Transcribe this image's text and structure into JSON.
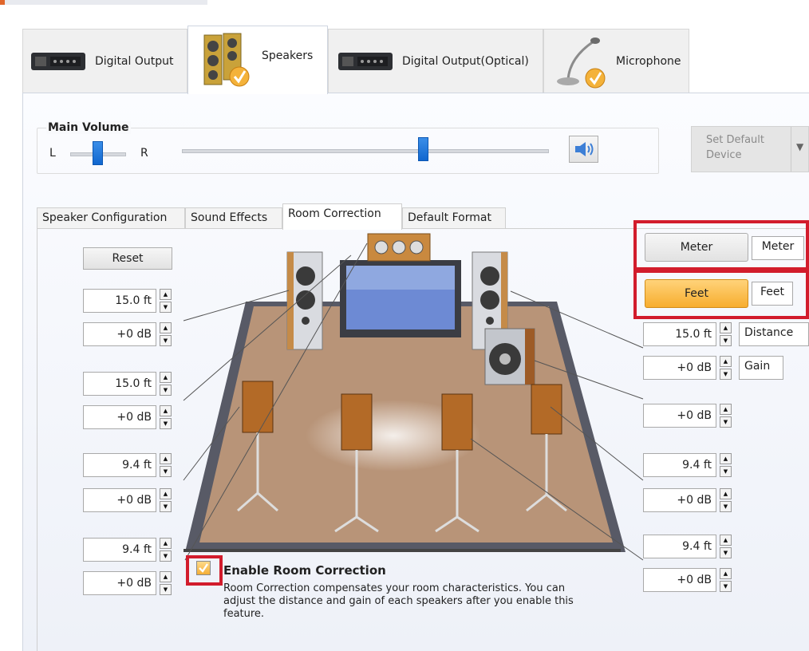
{
  "device_tabs": [
    {
      "label": "Digital Output",
      "icon": "digital-output-device-icon"
    },
    {
      "label": "Speakers",
      "icon": "speakers-device-icon"
    },
    {
      "label": "Digital Output(Optical)",
      "icon": "optical-output-device-icon"
    },
    {
      "label": "Microphone",
      "icon": "microphone-device-icon"
    }
  ],
  "main_volume": {
    "title": "Main Volume",
    "left_label": "L",
    "right_label": "R",
    "balance_level": 0.5,
    "volume_level": 0.66
  },
  "set_default": {
    "line1": "Set Default",
    "line2": "Device"
  },
  "sub_tabs": [
    "Speaker Configuration",
    "Sound Effects",
    "Room Correction",
    "Default Format"
  ],
  "reset_label": "Reset",
  "unit_meter": {
    "button": "Meter",
    "label": "Meter"
  },
  "unit_feet": {
    "button": "Feet",
    "label": "Feet"
  },
  "distance_label": "Distance",
  "gain_label": "Gain",
  "left_controls": [
    {
      "distance": "15.0 ft",
      "gain": "+0 dB"
    },
    {
      "distance": "15.0 ft",
      "gain": "+0 dB"
    },
    {
      "distance": "9.4 ft",
      "gain": "+0 dB"
    },
    {
      "distance": "9.4 ft",
      "gain": "+0 dB"
    }
  ],
  "right_controls": {
    "front": {
      "distance": "15.0 ft",
      "gain": "+0 dB"
    },
    "sub": {
      "gain": "+0 dB"
    },
    "side": {
      "distance": "9.4 ft",
      "gain": "+0 dB"
    },
    "rear": {
      "distance": "9.4 ft",
      "gain": "+0 dB"
    }
  },
  "room_correction": {
    "checked": true,
    "title": "Enable Room Correction",
    "description_lines": [
      "Room Correction compensates your room characteristics. You can",
      "adjust the distance and gain of each speakers after you enable this",
      "feature."
    ]
  },
  "colors": {
    "accent_blue": "#1167cf",
    "highlight_red": "#d21c2c",
    "feet_orange": "#fbb840",
    "floor": "#b89478"
  }
}
